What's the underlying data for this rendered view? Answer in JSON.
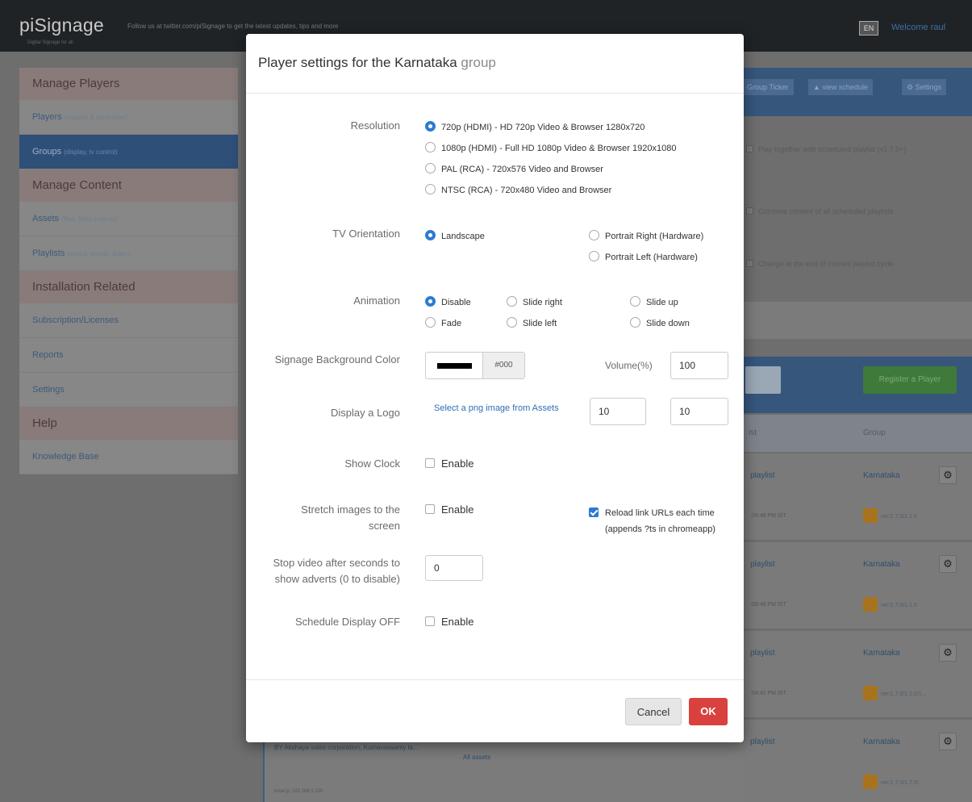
{
  "app": {
    "brand": "piSignage",
    "brand_sub": "Digital Signage for all",
    "tagline": "Follow us at twitter.com/piSignage to get the latest updates, tips and more",
    "lang": "EN",
    "welcome": "Welcome raul"
  },
  "sidebar": {
    "manage_players": "Manage Players",
    "players": "Players",
    "players_sub": "(register & administer)",
    "groups": "Groups",
    "groups_sub": "(display, tv control)",
    "manage_content": "Manage Content",
    "assets": "Assets",
    "assets_sub": "(files, links, notices)",
    "playlists": "Playlists",
    "playlists_sub": "(layout, assets, ticker)",
    "installation": "Installation Related",
    "subscription": "Subscription/Licenses",
    "reports": "Reports",
    "settings": "Settings",
    "help": "Help",
    "knowledge_base": "Knowledge Base"
  },
  "background": {
    "btn_ticker": "Group Ticker",
    "btn_schedule": "view schedule",
    "btn_settings": "Settings",
    "opt1": "Play together with scheduled playlist (v1.7.0+)",
    "opt2": "Combine content of all scheduled playlists",
    "opt3": "Change at the end of current playlist cycle",
    "register": "Register a Player",
    "col_playlist": "ist",
    "col_group": "Group",
    "rows": [
      {
        "playlist": "playlist",
        "group": "Karnataka",
        "ts": ":05:48 PM IST",
        "ver": "ver:1.7.0/1.1.0"
      },
      {
        "playlist": "playlist",
        "group": "Karnataka",
        "ts": ":09:48 PM IST",
        "ver": "ver:1.7.0/1.1.0"
      },
      {
        "playlist": "playlist",
        "group": "Karnataka",
        "ts": ":04:42 PM IST",
        "ver": "ver:1.7.0/1.1.0/1..."
      },
      {
        "playlist": "playlist",
        "group": "Karnataka",
        "ts": "",
        "ver": "ver:1.7.0/1.7.0/..."
      }
    ],
    "bottom_text": "BY Akshaya sales corporation, Kumaraswamy la...",
    "bottom_text2": "All assets",
    "bottom_meta": "local ip: 192.168.1.100"
  },
  "modal": {
    "title_prefix": "Player settings for the",
    "group_name": "Karnataka",
    "title_suffix": "group",
    "resolution_label": "Resolution",
    "resolutions": [
      "720p (HDMI) - HD 720p Video & Browser 1280x720",
      "1080p (HDMI) - Full HD 1080p Video & Browser 1920x1080",
      "PAL (RCA) - 720x576 Video and Browser",
      "NTSC (RCA) - 720x480 Video and Browser"
    ],
    "orientation_label": "TV Orientation",
    "orient_landscape": "Landscape",
    "orient_right": "Portrait Right (Hardware)",
    "orient_left": "Portrait Left (Hardware)",
    "animation_label": "Animation",
    "anim_disable": "Disable",
    "anim_fade": "Fade",
    "anim_slide_right": "Slide right",
    "anim_slide_left": "Slide left",
    "anim_slide_up": "Slide up",
    "anim_slide_down": "Slide down",
    "bgcolor_label": "Signage Background Color",
    "bgcolor_value": "#000",
    "volume_label": "Volume(%)",
    "volume_value": "100",
    "logo_label": "Display a Logo",
    "logo_link": "Select a png image from Assets",
    "logo_x": "10",
    "logo_y": "10",
    "clock_label": "Show Clock",
    "enable": "Enable",
    "stretch_label": "Stretch images to the screen",
    "reload_label": "Reload link URLs each time (appends ?ts in chromeapp)",
    "stopvideo_label": "Stop video after seconds to show adverts (0 to disable)",
    "stopvideo_value": "0",
    "schedule_off_label": "Schedule Display OFF",
    "cancel": "Cancel",
    "ok": "OK"
  },
  "colors": {
    "accent": "#2d7bd1",
    "ok_button": "#d9413e",
    "link": "#2d6fb6"
  }
}
